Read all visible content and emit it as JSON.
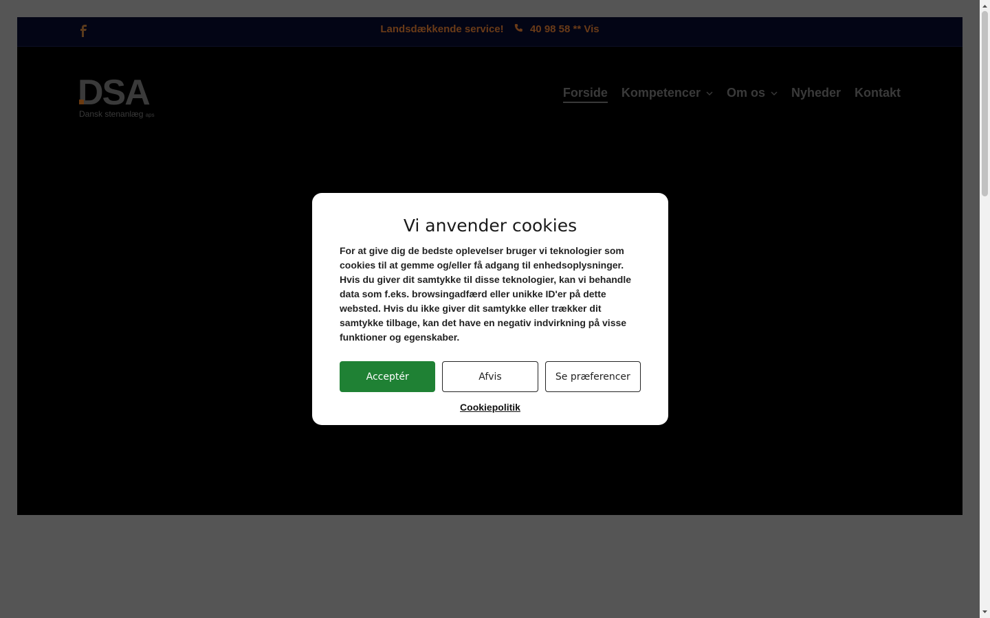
{
  "topbar": {
    "facebook_icon": "facebook-icon",
    "tagline": "Landsdækkende service!",
    "phone_icon": "phone-icon",
    "phone": "40 98 58 ** Vis"
  },
  "logo": {
    "mark": "DSA",
    "subtitle": "Dansk stenanlæg",
    "subtitle_suffix": "aps"
  },
  "nav": {
    "items": [
      {
        "label": "Forside",
        "active": true,
        "dropdown": false
      },
      {
        "label": "Kompetencer",
        "active": false,
        "dropdown": true
      },
      {
        "label": "Om os",
        "active": false,
        "dropdown": true
      },
      {
        "label": "Nyheder",
        "active": false,
        "dropdown": false
      },
      {
        "label": "Kontakt",
        "active": false,
        "dropdown": false
      }
    ]
  },
  "cookie_modal": {
    "title": "Vi anvender cookies",
    "body": "For at give dig de bedste oplevelser bruger vi teknologier som cookies til at gemme og/eller få adgang til enhedsoplysninger. Hvis du giver dit samtykke til disse teknologier, kan vi behandle data som f.eks. browsingadfærd eller unikke ID'er på dette websted. Hvis du ikke giver dit samtykke eller trækker dit samtykke tilbage, kan det have en negativ indvirkning på visse funktioner og egenskaber.",
    "accept_label": "Acceptér",
    "deny_label": "Afvis",
    "prefs_label": "Se præferencer",
    "policy_link": "Cookiepolitik"
  },
  "colors": {
    "accept_green": "#1f8134",
    "accent_brown": "#6a3b18",
    "topbar_navy": "#030515"
  }
}
